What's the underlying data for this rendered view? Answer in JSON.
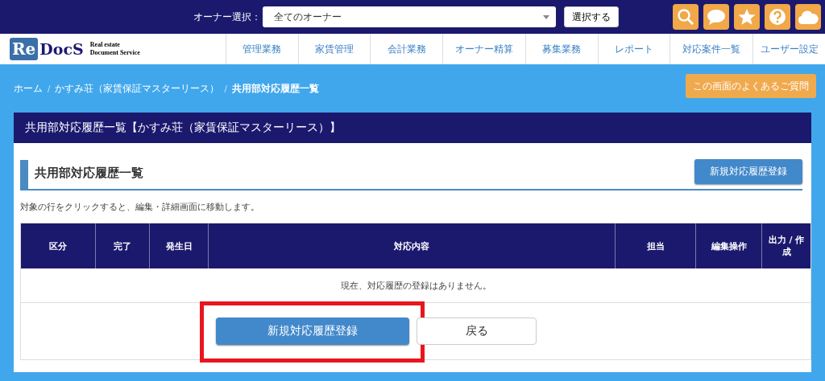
{
  "top_bar": {
    "owner_label": "オーナー選択：",
    "owner_select": {
      "value": "全てのオーナー"
    },
    "select_button": "選択する"
  },
  "logo": {
    "mark_re": "Re",
    "mark_docs": "DocS",
    "tagline_1": "Real estate",
    "tagline_2": "Document Service"
  },
  "nav": [
    "管理業務",
    "家賃管理",
    "会計業務",
    "オーナー精算",
    "募集業務",
    "レポート",
    "対応案件一覧",
    "ユーザー設定"
  ],
  "breadcrumb_separator": "/",
  "breadcrumb": [
    {
      "label": "ホーム",
      "current": false
    },
    {
      "label": "かすみ荘（家賃保証マスターリース）",
      "current": false
    },
    {
      "label": "共用部対応履歴一覧",
      "current": true
    }
  ],
  "faq_button": "この画面のよくあるご質問",
  "panel": {
    "title": "共用部対応履歴一覧【かすみ荘（家賃保証マスターリース）】",
    "section_title": "共用部対応履歴一覧",
    "new_button": "新規対応履歴登録",
    "note": "対象の行をクリックすると、編集・詳細画面に移動します。"
  },
  "table": {
    "columns": [
      "区分",
      "完了",
      "発生日",
      "対応内容",
      "担当",
      "編集操作",
      "出力 / 作成"
    ],
    "empty_message": "現在、対応履歴の登録はありません。"
  },
  "footer_buttons": [
    {
      "label": "新規対応履歴登録",
      "kind": "primary",
      "highlighted": true
    },
    {
      "label": "戻る",
      "kind": "secondary",
      "highlighted": false
    }
  ]
}
